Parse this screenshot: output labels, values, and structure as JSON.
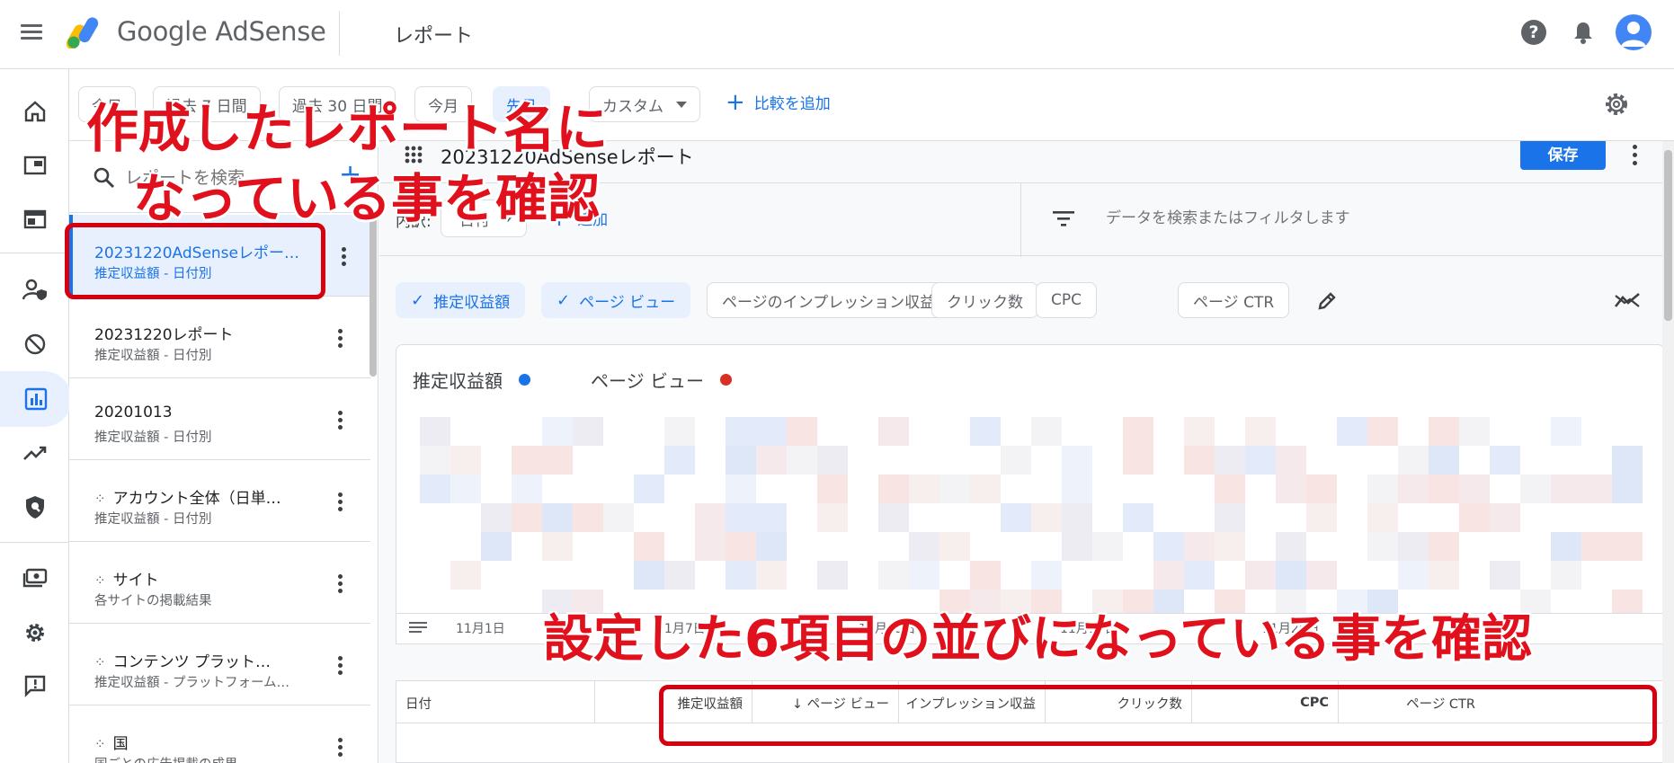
{
  "header": {
    "brand": "Google AdSense",
    "page_title": "レポート"
  },
  "datebar": {
    "chips": [
      "今日",
      "過去 7 日間",
      "過去 30 日間",
      "今月",
      "先月"
    ],
    "custom": "カスタム",
    "compare": "比較を追加"
  },
  "list": {
    "search_placeholder": "レポートを検索",
    "items": [
      {
        "name": "20231220AdSenseレポー…",
        "sub": "推定収益額 - 日付別",
        "auto": false
      },
      {
        "name": "20231220レポート",
        "sub": "推定収益額 - 日付別",
        "auto": false
      },
      {
        "name": "20201013",
        "sub": "推定収益額 - 日付別",
        "auto": false
      },
      {
        "name": "アカウント全体（日単…",
        "sub": "推定収益額 - 日付別",
        "auto": true
      },
      {
        "name": "サイト",
        "sub": "各サイトの掲載結果",
        "auto": true
      },
      {
        "name": "コンテンツ プラット…",
        "sub": "推定収益額 - プラットフォーム…",
        "auto": true
      },
      {
        "name": "国",
        "sub": "国ごとの広告掲載の成果",
        "auto": true
      }
    ]
  },
  "report": {
    "title": "20231220AdSenseレポート",
    "save": "保存",
    "breakdown_label": "内訳:",
    "breakdown_value": "日付",
    "add_breakdown": "追加",
    "filter_placeholder": "データを検索またはフィルタします",
    "metrics": [
      {
        "label": "推定収益額",
        "selected": true
      },
      {
        "label": "ページ ビュー",
        "selected": true
      },
      {
        "label": "ページのインプレッション収益",
        "selected": false
      },
      {
        "label": "クリック数",
        "selected": false
      },
      {
        "label": "CPC",
        "selected": false
      },
      {
        "label": "ページ CTR",
        "selected": false
      }
    ],
    "legend": [
      {
        "label": "推定収益額",
        "color": "#1a73e8"
      },
      {
        "label": "ページ ビュー",
        "color": "#d93025"
      }
    ],
    "axis_labels": [
      "11月1日",
      "11月7日",
      "11月13日",
      "11月19日",
      "11月25日"
    ],
    "table_headers": [
      "日付",
      "推定収益額",
      "↓ ページ ビュー",
      "ページのインプレッション収益",
      "クリック数",
      "CPC",
      "ページ CTR"
    ]
  },
  "annotations": {
    "top_line1": "作成したレポート名に",
    "top_line2": "なっている事を確認",
    "bottom": "設定した6項目の並びになっている事を確認"
  },
  "colors": {
    "accent": "#1a73e8",
    "annotation_red": "#e0101c"
  }
}
